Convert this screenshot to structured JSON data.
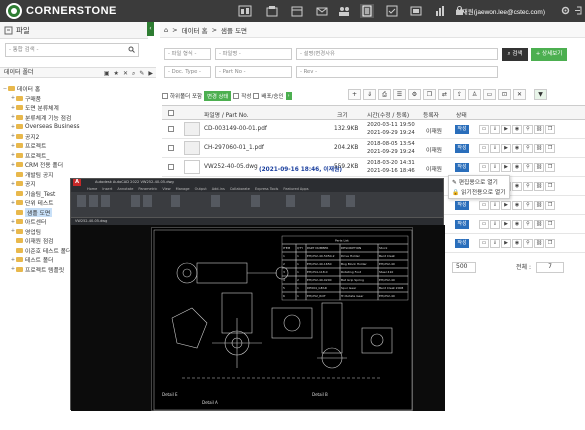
{
  "app": {
    "logo_text": "CORNERSTONE"
  },
  "topbar": {
    "user": "이재원(jaewon.lee@cstec.com)",
    "colors": {
      "bg": "#3b3b3b",
      "brand": "#2e7d32"
    }
  },
  "left": {
    "title": "파일",
    "search_placeholder": "- 통합 검색 -",
    "folder_bar_label": "데이터 폴더",
    "tree": [
      {
        "label": "데이터 홈",
        "depth": 0,
        "expander": "−"
      },
      {
        "label": "구매품",
        "depth": 1,
        "expander": "+"
      },
      {
        "label": "도면 분류체계",
        "depth": 1,
        "expander": "+"
      },
      {
        "label": "분류체계 기능 점검",
        "depth": 1,
        "expander": "+"
      },
      {
        "label": "Overseas Business",
        "depth": 1,
        "expander": "+"
      },
      {
        "label": "공지2",
        "depth": 1,
        "expander": "+"
      },
      {
        "label": "프로젝트",
        "depth": 1,
        "expander": "+"
      },
      {
        "label": "프로젝트_",
        "depth": 1,
        "expander": "+"
      },
      {
        "label": "CRM 전용 폴더",
        "depth": 1,
        "expander": "+"
      },
      {
        "label": "개발팀 공지",
        "depth": 1,
        "expander": ""
      },
      {
        "label": "공지",
        "depth": 1,
        "expander": "+"
      },
      {
        "label": "기술팀_Test",
        "depth": 1,
        "expander": ""
      },
      {
        "label": "단위 테스트",
        "depth": 1,
        "expander": "+"
      },
      {
        "label": "샘플 도면",
        "depth": 1,
        "expander": "",
        "selected": true
      },
      {
        "label": "아트센터",
        "depth": 1,
        "expander": "+"
      },
      {
        "label": "영업팀",
        "depth": 1,
        "expander": "+"
      },
      {
        "label": "이재원 점검",
        "depth": 1,
        "expander": ""
      },
      {
        "label": "이준호 테스트 폴더",
        "depth": 1,
        "expander": ""
      },
      {
        "label": "테스트 폴더",
        "depth": 1,
        "expander": "+"
      },
      {
        "label": "프로젝트 템플릿",
        "depth": 1,
        "expander": "+"
      }
    ]
  },
  "breadcrumb": {
    "home": "데이터 홈",
    "sep": ">",
    "current": "샘플 도면"
  },
  "filters": {
    "file_type": "- 파일 형식 -",
    "file_name": "- 파일명 -",
    "description": "- 설명(변경사유",
    "doc_type": "- Doc. Type -",
    "part_no": "- Part No -",
    "rev": "- Rev -",
    "search_button": "검색",
    "detail_button": "상세보기"
  },
  "options": {
    "include_subfolders": "하위폴더 포함",
    "work_status": "변경 상태",
    "draft": "작성",
    "distribution": "배포/승인"
  },
  "table": {
    "headers": {
      "name": "파일명 / Part No.",
      "size": "크기",
      "time": "시간(수정 / 등록)",
      "registrant": "등록자",
      "state": "상태"
    },
    "rows": [
      {
        "name": "CD-003149-00-01.pdf",
        "size": "132.9KB",
        "modified": "2020-03-11 19:50",
        "registered": "2021-09-29 19:24",
        "registrant": "이재원",
        "state": "작성"
      },
      {
        "name": "CH-297060-01_1.pdf",
        "size": "204.2KB",
        "modified": "2018-08-05 13:54",
        "registered": "2021-09-29 19:24",
        "registrant": "이재원",
        "state": "작성"
      },
      {
        "name": "VW252-40-05.dwg",
        "name_note": "(2021-09-16 18:46, 이재원)",
        "size": "559.2KB",
        "modified": "2018-03-20 14:31",
        "registered": "2021-09-16 18:46",
        "registrant": "이재원",
        "state": "작성"
      },
      {
        "state": "작성"
      },
      {
        "state": "작성"
      },
      {
        "state": "작성"
      },
      {
        "state": "작성"
      }
    ]
  },
  "context_menu": {
    "edit": "편집용으로 열기",
    "read": "읽기전용으로 열기"
  },
  "pager": {
    "page_size": "500",
    "total_label": "전체 :",
    "total": "7"
  },
  "cad": {
    "title": "Autodesk AutoCAD 2022   VW252-40-05.dwg",
    "menu": [
      "Home",
      "Insert",
      "Annotate",
      "Parametric",
      "View",
      "Manage",
      "Output",
      "Add-ins",
      "Collaborate",
      "Express Tools",
      "Featured Apps"
    ],
    "tab": "VW252-40-05.dwg",
    "parts_list_title": "Parts List",
    "parts_headers": [
      "ITEM",
      "QTY",
      "PART NUMBER",
      "DESCRIPTION",
      "Stock"
    ],
    "parts_rows": [
      [
        "1",
        "1",
        "EH/252-40-5050-2",
        "Drive Holder",
        "Bent Cleat"
      ],
      [
        "2",
        "1",
        "EH/252-40-1650",
        "Bog Block Holder",
        "EH/252-40"
      ],
      [
        "3",
        "1",
        "EH/254-118.0",
        "Rotating Foot",
        "Steel 410"
      ],
      [
        "4",
        "2",
        "EH/252-40-0200",
        "Bat Grip Spring",
        "EH/252-40"
      ],
      [
        "5",
        "1",
        "DE004_GEAR",
        "Spur Gear",
        "Bent Cleat 2008"
      ],
      [
        "6",
        "1",
        "EH/252_ROT",
        "Tri Rotate Gear",
        "EH/252-40"
      ]
    ],
    "details": [
      "Detail A",
      "Detail B",
      "Detail E"
    ]
  }
}
